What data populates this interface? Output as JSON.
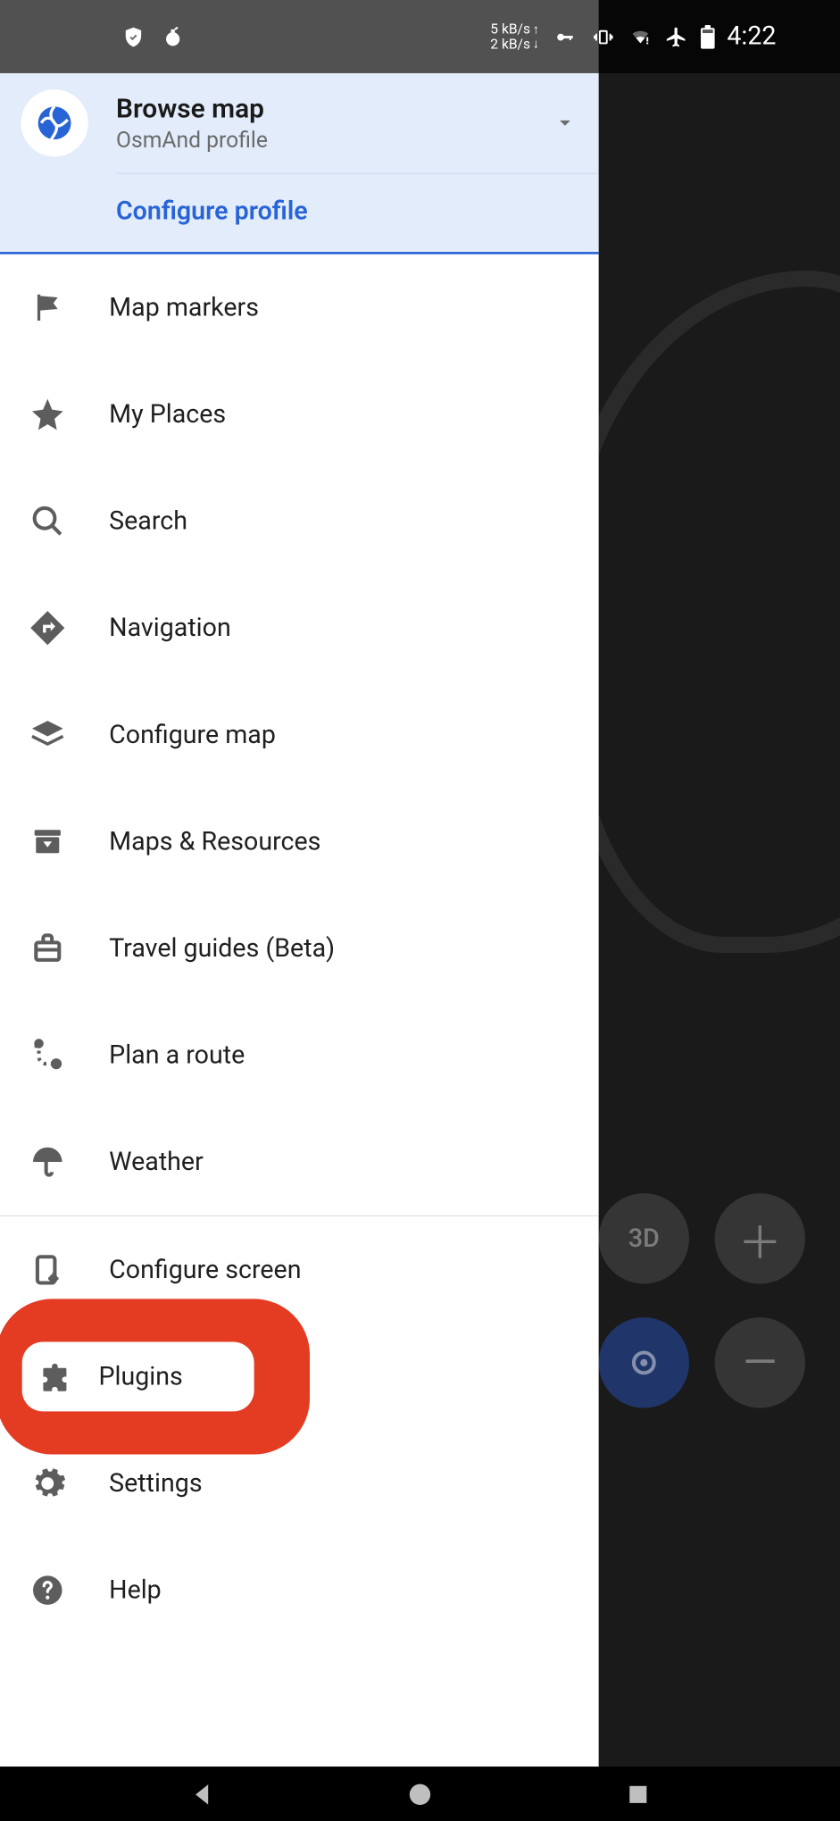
{
  "status_bar": {
    "net_up": "5 kB/s",
    "net_down": "2 kB/s",
    "time": "4:22"
  },
  "profile": {
    "title": "Browse map",
    "subtitle": "OsmAnd profile",
    "configure_label": "Configure profile"
  },
  "menu": {
    "items": [
      {
        "icon": "flag-icon",
        "label": "Map markers"
      },
      {
        "icon": "star-icon",
        "label": "My Places"
      },
      {
        "icon": "search-icon",
        "label": "Search"
      },
      {
        "icon": "directions-icon",
        "label": "Navigation"
      },
      {
        "icon": "layers-icon",
        "label": "Configure map"
      },
      {
        "icon": "archive-down-icon",
        "label": "Maps & Resources"
      },
      {
        "icon": "briefcase-icon",
        "label": "Travel guides (Beta)"
      },
      {
        "icon": "route-icon",
        "label": "Plan a route"
      },
      {
        "icon": "umbrella-icon",
        "label": "Weather"
      },
      {
        "icon": "screen-config-icon",
        "label": "Configure screen"
      },
      {
        "icon": "puzzle-icon",
        "label": "Plugins"
      },
      {
        "icon": "gear-icon",
        "label": "Settings"
      },
      {
        "icon": "help-icon",
        "label": "Help"
      }
    ]
  },
  "highlight_index": 10,
  "map_buttons": {
    "threeD": "3D",
    "zoom_in": "＋",
    "zoom_out": "—",
    "locate": "◎"
  }
}
